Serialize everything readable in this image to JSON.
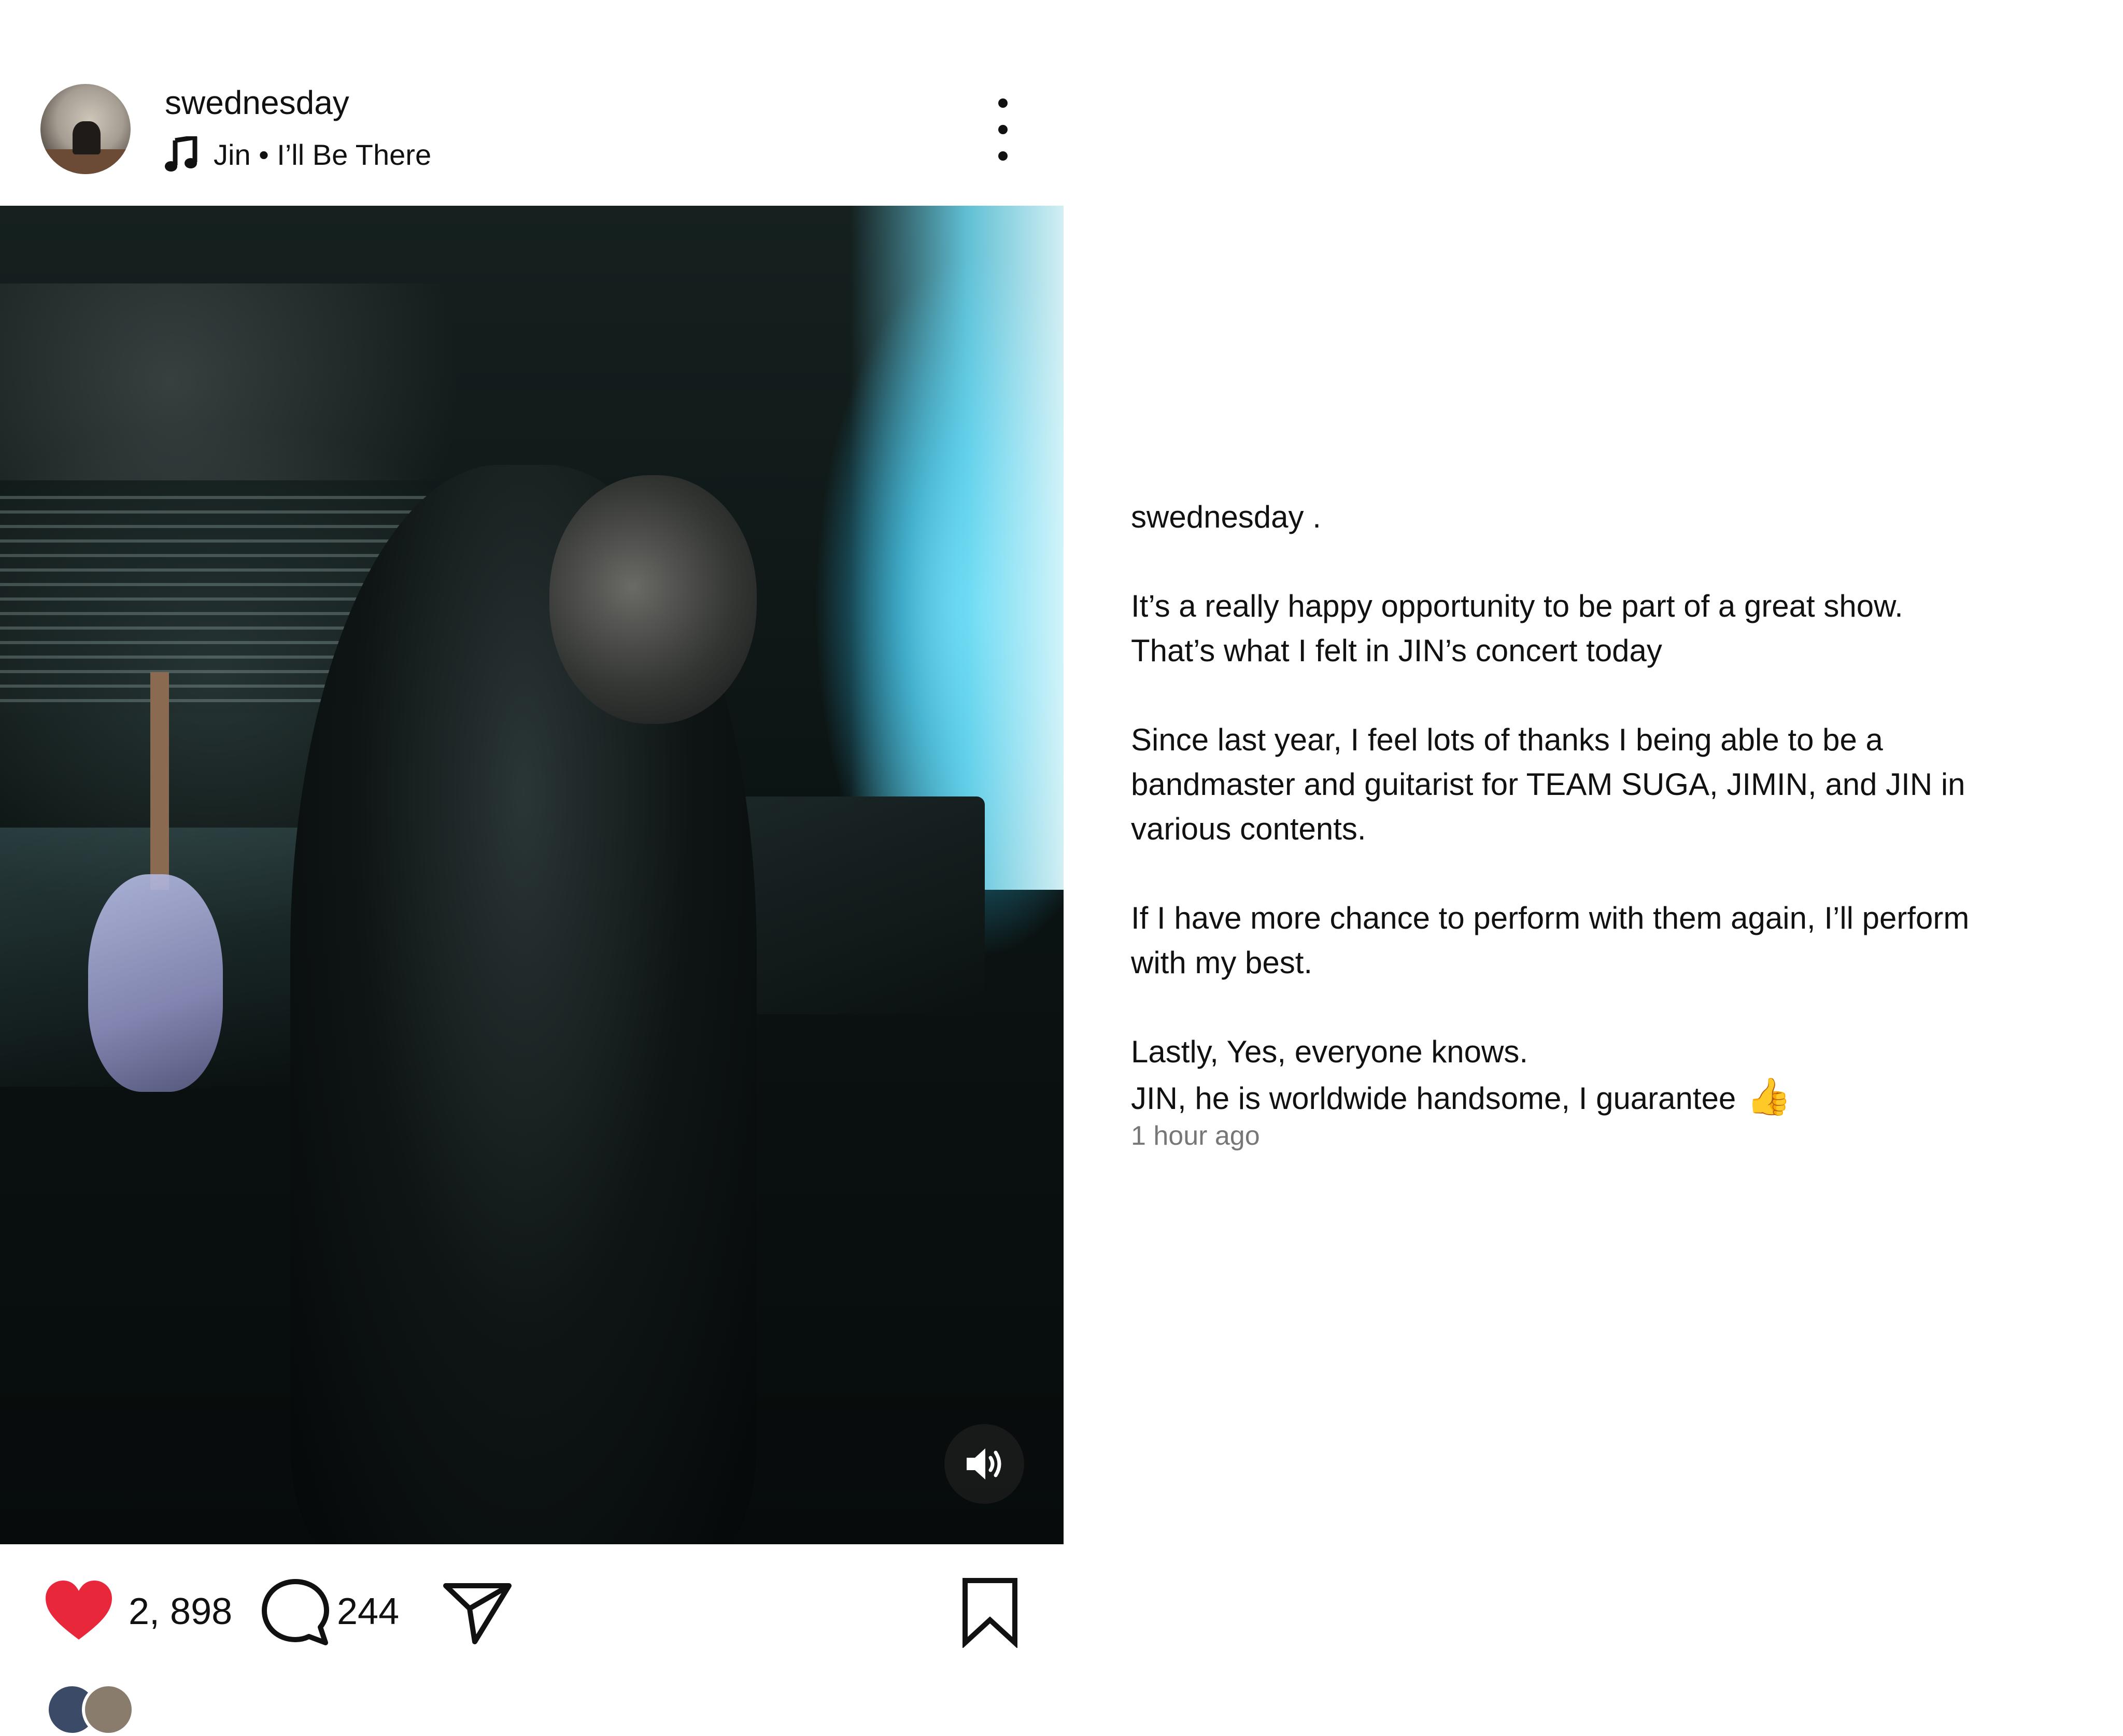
{
  "header": {
    "username": "swednesday",
    "music": {
      "icon": "music-note-icon",
      "text": "Jin • I’ll Be There"
    },
    "more_icon": "more-vertical-icon"
  },
  "media": {
    "description_icon": "photo",
    "sound_icon": "volume-on-icon"
  },
  "actions": {
    "like_icon": "heart-filled-icon",
    "like_color": "#e8283a",
    "likes_count": "2, 898",
    "comment_icon": "comment-icon",
    "comments_count": "244",
    "share_icon": "send-icon",
    "save_icon": "bookmark-icon"
  },
  "caption": {
    "username": "swednesday .",
    "paragraphs": [
      {
        "lines": [
          "It’s a really happy opportunity to be part of a great show.",
          "That’s what I felt in JIN’s concert today"
        ]
      },
      {
        "lines": [
          "Since last year,  I feel lots of thanks I being able to be a",
          "bandmaster and guitarist for TEAM SUGA,  JIMIN,  and JIN in",
          "various contents."
        ]
      },
      {
        "lines": [
          "If I have more chance to perform with them again,  I’ll perform",
          "with my best."
        ]
      },
      {
        "lines": [
          "Lastly,  Yes,  everyone knows.",
          "JIN,  he is worldwide handsome,  I guarantee"
        ],
        "emoji": "👍"
      }
    ],
    "timestamp": "1 hour ago"
  }
}
